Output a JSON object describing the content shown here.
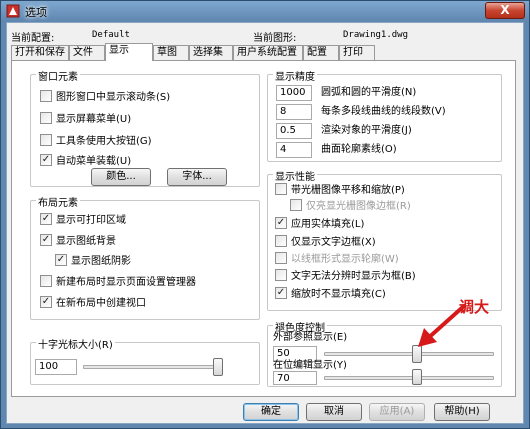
{
  "window": {
    "title": "选项",
    "close_label": "X"
  },
  "config": {
    "profile_label": "当前配置:",
    "profile_value": "Default",
    "drawing_label": "当前图形:",
    "drawing_value": "Drawing1.dwg"
  },
  "tabs": [
    {
      "label": "打开和保存"
    },
    {
      "label": "文件"
    },
    {
      "label": "显示",
      "active": true
    },
    {
      "label": "草图"
    },
    {
      "label": "选择集"
    },
    {
      "label": "用户系统配置"
    },
    {
      "label": "配置"
    },
    {
      "label": "打印"
    }
  ],
  "window_elements": {
    "title": "窗口元素",
    "items": [
      {
        "label": "图形窗口中显示滚动条(S)",
        "checked": false
      },
      {
        "label": "显示屏幕菜单(U)",
        "checked": false
      },
      {
        "label": "工具条使用大按钮(G)",
        "checked": false
      },
      {
        "label": "自动菜单装载(U)",
        "checked": true
      }
    ],
    "color_button": "颜色...",
    "font_button": "字体..."
  },
  "layout_elements": {
    "title": "布局元素",
    "items": [
      {
        "label": "显示可打印区域",
        "checked": true
      },
      {
        "label": "显示图纸背景",
        "checked": true
      },
      {
        "label": "显示图纸阴影",
        "checked": true
      },
      {
        "label": "新建布局时显示页面设置管理器",
        "checked": false
      },
      {
        "label": "在新布局中创建视口",
        "checked": true
      }
    ]
  },
  "crosshair": {
    "title": "十字光标大小(R)",
    "value": "100",
    "slider_fraction": 1.0
  },
  "precision": {
    "title": "显示精度",
    "items": [
      {
        "value": "1000",
        "label": "圆弧和圆的平滑度(N)"
      },
      {
        "value": "8",
        "label": "每条多段线曲线的线段数(V)"
      },
      {
        "value": "0.5",
        "label": "渲染对象的平滑度(J)"
      },
      {
        "value": "4",
        "label": "曲面轮廓素线(O)"
      }
    ]
  },
  "performance": {
    "title": "显示性能",
    "items": [
      {
        "label": "带光栅图像平移和缩放(P)",
        "checked": false,
        "disabled": false
      },
      {
        "label": "仅亮显光栅图像边框(R)",
        "checked": false,
        "disabled": true
      },
      {
        "label": "应用实体填充(L)",
        "checked": true,
        "disabled": false
      },
      {
        "label": "仅显示文字边框(X)",
        "checked": false,
        "disabled": false
      },
      {
        "label": "以线框形式显示轮廓(W)",
        "checked": false,
        "disabled": true
      },
      {
        "label": "文字无法分辨时显示为框(B)",
        "checked": false,
        "disabled": false
      },
      {
        "label": "缩放时不显示填充(C)",
        "checked": true,
        "disabled": false
      }
    ]
  },
  "fade": {
    "title": "褪色度控制",
    "xref_label": "外部参照显示(E)",
    "xref_value": "50",
    "xref_fraction": 0.55,
    "inplace_label": "在位编辑显示(Y)",
    "inplace_value": "70",
    "inplace_fraction": 0.55
  },
  "annotation": {
    "text": "调大",
    "color": "#d61a1a"
  },
  "buttons": {
    "ok": "确定",
    "cancel": "取消",
    "apply": "应用(A)",
    "help": "帮助(H)"
  }
}
